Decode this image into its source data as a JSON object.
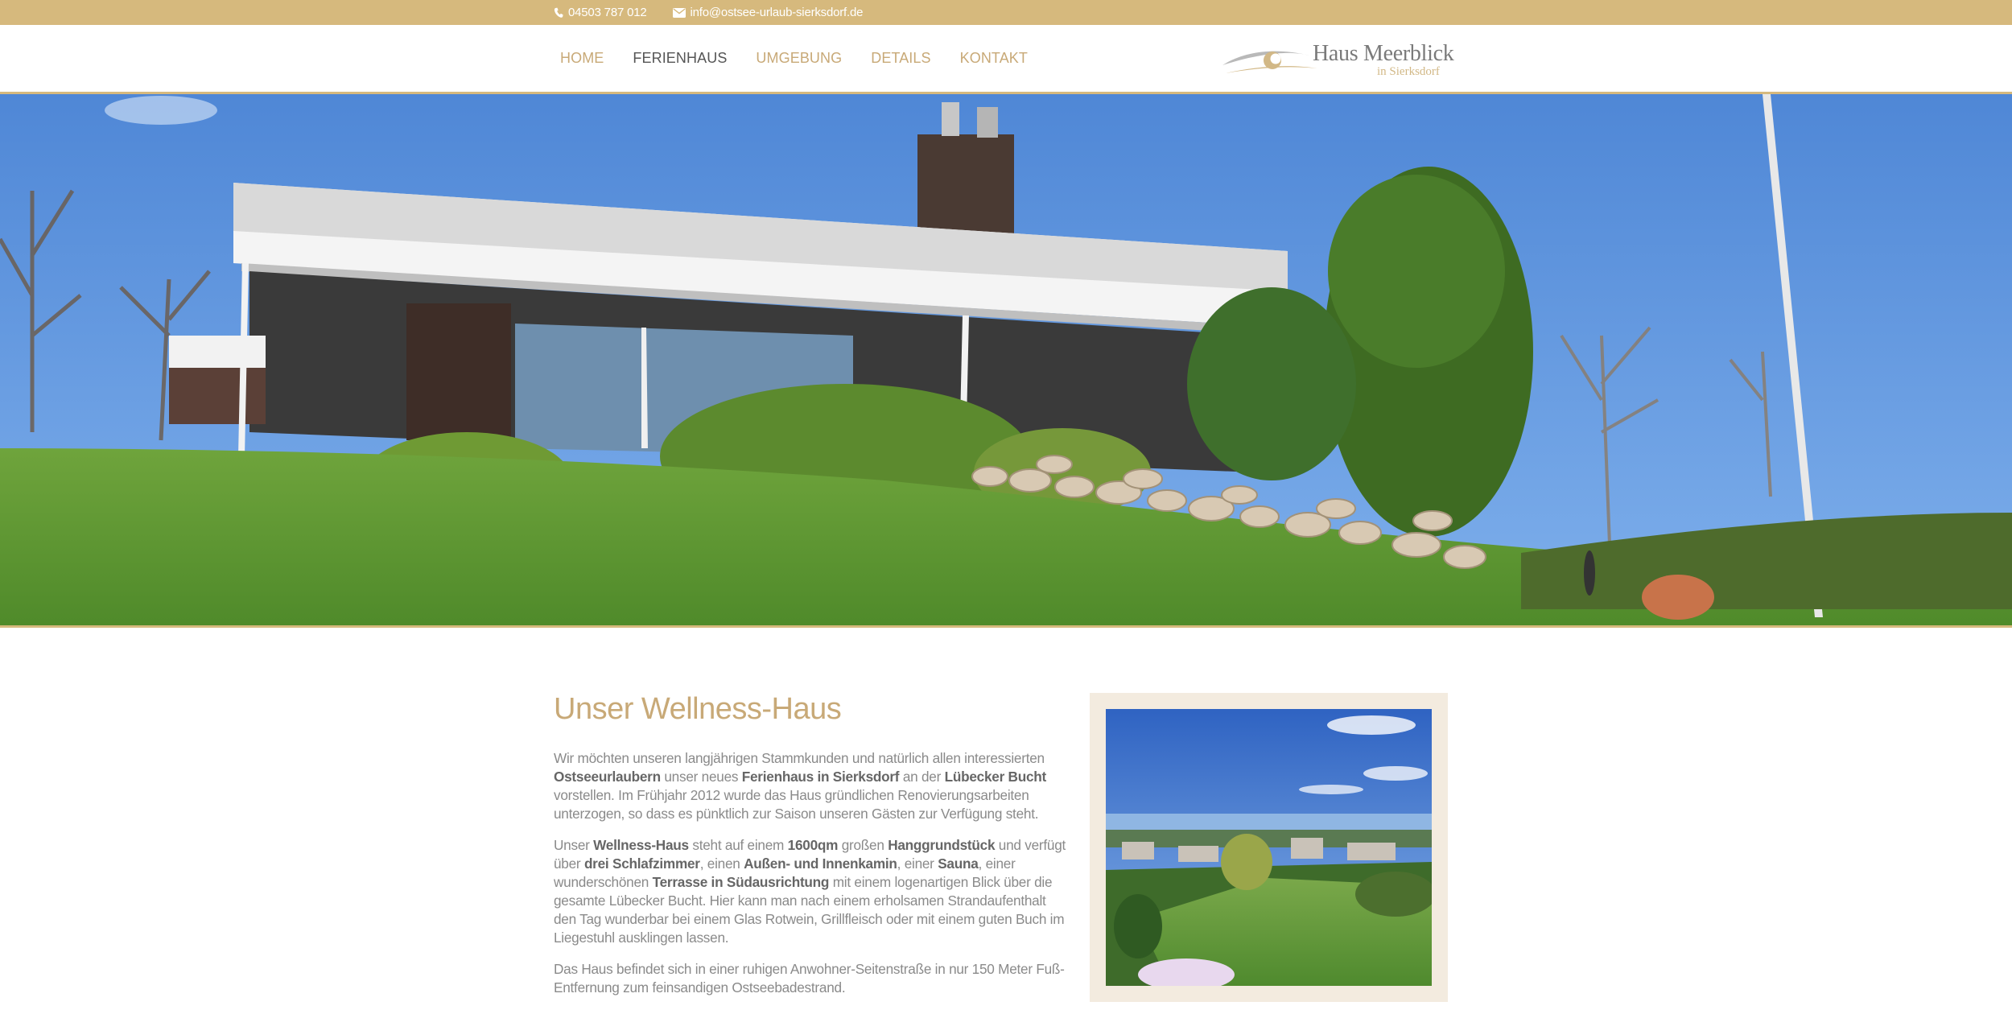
{
  "topbar": {
    "phone": "04503 787 012",
    "email": "info@ostsee-urlaub-sierksdorf.de",
    "phone_icon": "phone-icon",
    "email_icon": "envelope-icon"
  },
  "nav": {
    "items": [
      {
        "label": "HOME"
      },
      {
        "label": "FERIENHAUS"
      },
      {
        "label": "UMGEBUNG"
      },
      {
        "label": "DETAILS"
      },
      {
        "label": "KONTAKT"
      }
    ],
    "active_index": 1
  },
  "logo": {
    "title": "Haus Meerblick",
    "subtitle": "in Sierksdorf"
  },
  "colors": {
    "accent": "#d6b97d",
    "heading": "#c8a977",
    "text": "#8a8a8a",
    "frame": "#f3ebdf"
  },
  "main": {
    "title": "Unser Wellness-Haus",
    "p1": {
      "t1": "Wir möchten unseren langjährigen Stammkunden und natürlich allen interessierten ",
      "b1": "Ostseeurlaubern",
      "t2": " unser neues ",
      "b2": "Ferienhaus in Sierksdorf",
      "t3": " an der ",
      "b3": "Lübecker Bucht",
      "t4": " vorstellen. Im Frühjahr 2012 wurde das Haus gründlichen Renovierungsarbeiten unterzogen, so dass es pünktlich zur Saison unseren Gästen zur Verfügung steht."
    },
    "p2": {
      "t1": "Unser ",
      "b1": "Wellness-Haus",
      "t2": " steht auf einem ",
      "b2": "1600qm",
      "t3": " großen ",
      "b3": "Hanggrundstück",
      "t4": " und verfügt über ",
      "b4": "drei Schlafzimmer",
      "t5": ", einen ",
      "b5": "Außen- und Innenkamin",
      "t6": ", einer ",
      "b6": "Sauna",
      "t7": ", einer wunderschönen ",
      "b7": "Terrasse in Südausrichtung",
      "t8": " mit einem logenartigen Blick über die gesamte Lübecker Bucht. Hier kann man nach einem erholsamen Strandaufenthalt den Tag wunderbar bei einem Glas Rotwein, Grillfleisch oder mit einem guten Buch im Liegestuhl ausklingen lassen."
    },
    "p3": "Das Haus befindet sich in einer ruhigen Anwohner-Seitenstraße in nur 150 Meter Fuß-Entfernung zum feinsandigen Ostseebadestrand."
  }
}
